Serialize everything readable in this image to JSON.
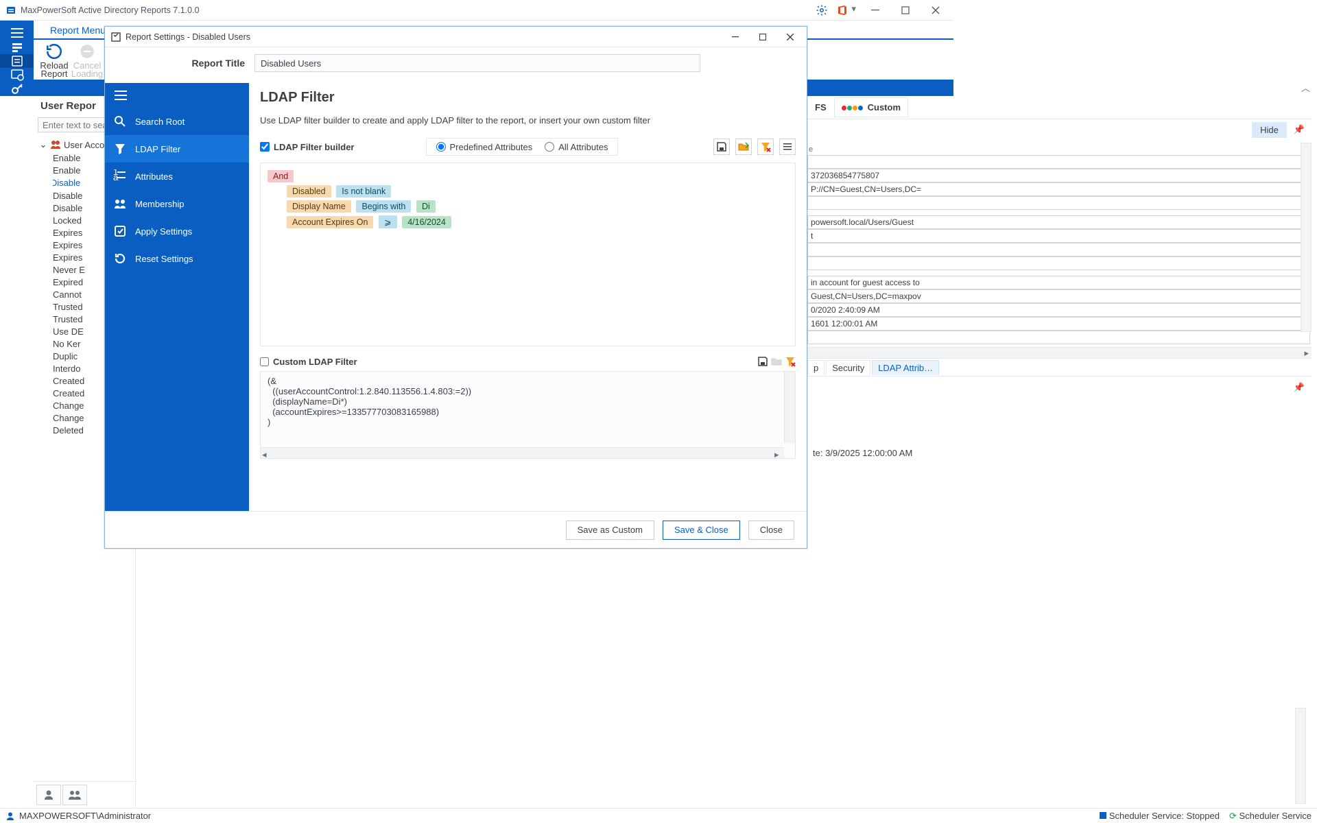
{
  "app": {
    "title": "MaxPowerSoft Active Directory Reports 7.1.0.0"
  },
  "ribbon": {
    "tab": "Report Menu",
    "reload": {
      "line1": "Reload",
      "line2": "Report"
    },
    "cancel": {
      "line1": "Cancel",
      "line2": "Loading"
    }
  },
  "tree": {
    "title": "User Repor",
    "search_placeholder": "Enter text to sea",
    "root": "User Acco",
    "selected": "Disable",
    "items": [
      "Enable",
      "Enable",
      "Disable",
      "Disable",
      "Disable",
      "Locked",
      "Expires",
      "Expires",
      "Expires",
      "Never E",
      "Expired",
      "Cannot",
      "Trusted",
      "Trusted",
      "Use DE",
      "No Ker",
      "Duplic",
      "Interdo",
      "Created",
      "Created",
      "Change",
      "Change",
      "Deleted"
    ]
  },
  "rightPanel": {
    "tabFS": "FS",
    "tabCustom": "Custom",
    "hide": "Hide",
    "groups": {
      "gA_val1": "372036854775807",
      "gA_val2": "P://CN=Guest,CN=Users,DC=",
      "gB_val1": "powersoft.local/Users/Guest",
      "gB_val2": "t",
      "gC_val1": "in account for guest access to",
      "gC_val2": "Guest,CN=Users,DC=maxpov",
      "gC_val3": "0/2020 2:40:09 AM",
      "gC_val4": "1601 12:00:01 AM"
    },
    "bottomTabs": {
      "t1": "p",
      "t2": "Security",
      "t3": "LDAP Attrib…"
    },
    "date": "te: 3/9/2025 12:00:00 AM"
  },
  "statusbar": {
    "user": "MAXPOWERSOFT\\Administrator",
    "svc1": "Scheduler Service: Stopped",
    "svc2": "Scheduler Service"
  },
  "dialog": {
    "title": "Report Settings - Disabled Users",
    "report_title_label": "Report Title",
    "report_title_value": "Disabled Users",
    "nav": {
      "search_root": "Search Root",
      "ldap_filter": "LDAP Filter",
      "attributes": "Attributes",
      "membership": "Membership",
      "apply": "Apply Settings",
      "reset": "Reset Settings"
    },
    "main": {
      "heading": "LDAP Filter",
      "sub": "Use LDAP filter builder to create and apply LDAP filter to the report, or insert your own custom filter",
      "builder_label": "LDAP Filter builder",
      "radio_predef": "Predefined Attributes",
      "radio_all": "All Attributes",
      "tokens": {
        "and": "And",
        "r1_attr": "Disabled",
        "r1_op": "Is not blank",
        "r2_attr": "Display Name",
        "r2_op": "Begins with",
        "r2_val": "Di",
        "r3_attr": "Account Expires On",
        "r3_op": "⩾",
        "r3_val": "4/16/2024"
      },
      "custom_label": "Custom LDAP Filter",
      "custom_text_l1": "(&",
      "custom_text_l2": "  ((userAccountControl:1.2.840.113556.1.4.803:=2))",
      "custom_text_l3": "  (displayName=Di*)",
      "custom_text_l4": "  (accountExpires>=133577703083165988)",
      "custom_text_l5": ")"
    },
    "footer": {
      "save_custom": "Save as Custom",
      "save_close": "Save & Close",
      "close": "Close"
    }
  }
}
